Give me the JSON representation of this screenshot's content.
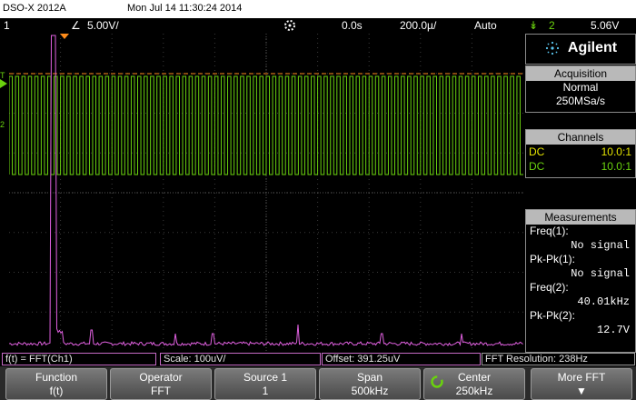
{
  "header": {
    "model": "DSO-X 2012A",
    "datetime": "Mon Jul 14 11:30:24 2014"
  },
  "channel_bar": {
    "ch1_num": "1",
    "ch1_scale": "5.00V/",
    "time_delay": "0.0s",
    "time_scale": "200.0µ/",
    "trigger_mode": "Auto",
    "trig_source": "2",
    "trig_level": "5.06V"
  },
  "panel": {
    "brand": "Agilent",
    "acquisition": {
      "title": "Acquisition",
      "mode": "Normal",
      "rate": "250MSa/s"
    },
    "channels": {
      "title": "Channels",
      "rows": [
        {
          "coupling": "DC",
          "probe": "10.0:1",
          "color": "#e4e400"
        },
        {
          "coupling": "DC",
          "probe": "10.0:1",
          "color": "#6ad20e"
        }
      ]
    },
    "measurements": {
      "title": "Measurements",
      "items": [
        {
          "label": "Freq(1):",
          "value": "No signal"
        },
        {
          "label": "Pk-Pk(1):",
          "value": "No signal"
        },
        {
          "label": "Freq(2):",
          "value": "40.01kHz"
        },
        {
          "label": "Pk-Pk(2):",
          "value": "12.7V"
        }
      ]
    }
  },
  "fft_bar": {
    "source": "f(t) = FFT(Ch1)",
    "scale": "Scale: 100uV/",
    "offset": "Offset: 391.25uV",
    "resolution": "FFT Resolution: 238Hz"
  },
  "softkeys": [
    {
      "title": "Function",
      "value": "f(t)"
    },
    {
      "title": "Operator",
      "value": "FFT"
    },
    {
      "title": "Source 1",
      "value": "1"
    },
    {
      "title": "Span",
      "value": "500kHz"
    },
    {
      "title": "Center",
      "value": "250kHz"
    },
    {
      "title": "More FFT",
      "value": ""
    }
  ],
  "colors": {
    "ch1": "#e4e400",
    "ch2": "#6ad20e",
    "math": "#e060e0",
    "trigger_line": "#ff8c1a"
  },
  "waveform": {
    "ch2_frequency_hz": 40010,
    "ch2_pkpk_v": 12.7
  }
}
